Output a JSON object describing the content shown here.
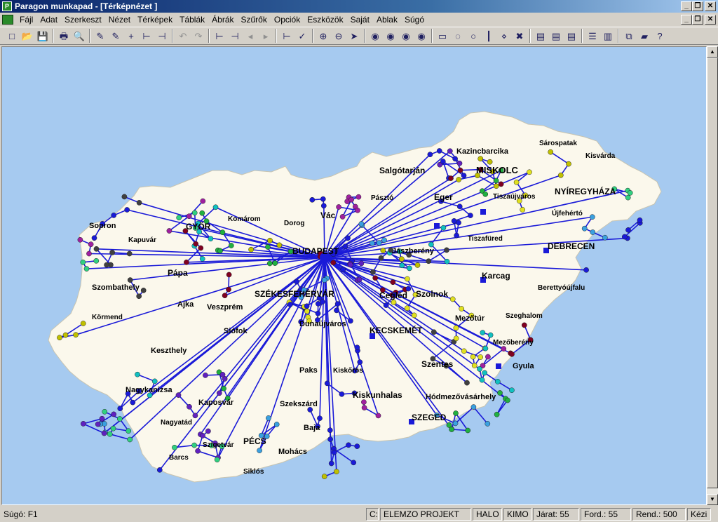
{
  "window": {
    "title": "Paragon munkapad - [Térképnézet ]",
    "controls": [
      "_",
      "❐",
      "✕"
    ]
  },
  "menu": [
    "Fájl",
    "Adat",
    "Szerkeszt",
    "Nézet",
    "Térképek",
    "Táblák",
    "Ábrák",
    "Szűrők",
    "Opciók",
    "Eszközök",
    "Saját",
    "Ablak",
    "Súgó"
  ],
  "toolbar": {
    "icons": [
      "new-icon",
      "open-icon",
      "save-icon",
      "print-icon",
      "print-preview-icon",
      "edit-route-icon",
      "edit-stop-icon",
      "add-stop-icon",
      "split-icon",
      "merge-icon",
      "undo-icon",
      "redo-icon",
      "move-left-icon",
      "move-right-icon",
      "arrow-left-icon",
      "arrow-right-icon",
      "insert-icon",
      "check-icon",
      "zoom-in-icon",
      "zoom-out-icon",
      "pointer-icon",
      "globe-1-icon",
      "globe-2-icon",
      "globe-3-icon",
      "globe-4-icon",
      "select-rect-icon",
      "select-lasso-icon",
      "select-circle-icon",
      "select-line-icon",
      "select-point-icon",
      "select-clear-icon",
      "table-1-icon",
      "table-2-icon",
      "table-3-icon",
      "chart-table-icon",
      "chart-bar-icon",
      "copy-icon",
      "book-icon",
      "help-icon"
    ],
    "glyphs": [
      "□",
      "📂",
      "💾",
      "🖶",
      "🔍",
      "✎",
      "✎",
      "+",
      "⊢",
      "⊣",
      "↶",
      "↷",
      "⊢",
      "⊣",
      "◂",
      "▸",
      "⊢",
      "✓",
      "⊕",
      "⊖",
      "➤",
      "◉",
      "◉",
      "◉",
      "◉",
      "▭",
      "◌",
      "○",
      "┃",
      "⋄",
      "✖",
      "▤",
      "▤",
      "▤",
      "☰",
      "▥",
      "⧉",
      "▰",
      "?"
    ]
  },
  "map": {
    "hub": "BUDAPEST",
    "cities": [
      {
        "name": "Sopron",
        "size": 11
      },
      {
        "name": "GYŐR",
        "size": 12
      },
      {
        "name": "Komárom",
        "size": 10
      },
      {
        "name": "Dorog",
        "size": 10
      },
      {
        "name": "Vác",
        "size": 12
      },
      {
        "name": "Salgótarján",
        "size": 12
      },
      {
        "name": "Pásztó",
        "size": 10
      },
      {
        "name": "Kazincbarcika",
        "size": 11
      },
      {
        "name": "MISKOLC",
        "size": 13
      },
      {
        "name": "Sárospatak",
        "size": 10
      },
      {
        "name": "Kisvárda",
        "size": 10
      },
      {
        "name": "Tiszaújváros",
        "size": 10
      },
      {
        "name": "NYÍREGYHÁZA",
        "size": 12
      },
      {
        "name": "Újfehértó",
        "size": 10
      },
      {
        "name": "Eger",
        "size": 12
      },
      {
        "name": "Tiszafüred",
        "size": 10
      },
      {
        "name": "DEBRECEN",
        "size": 12
      },
      {
        "name": "Jászberény",
        "size": 11
      },
      {
        "name": "Karcag",
        "size": 12
      },
      {
        "name": "Berettyóújfalu",
        "size": 10
      },
      {
        "name": "Szolnok",
        "size": 12
      },
      {
        "name": "Cegléd",
        "size": 12
      },
      {
        "name": "Mezőtúr",
        "size": 11
      },
      {
        "name": "Szeghalom",
        "size": 10
      },
      {
        "name": "Mezőberény",
        "size": 10
      },
      {
        "name": "Gyula",
        "size": 11
      },
      {
        "name": "KECSKEMÉT",
        "size": 12
      },
      {
        "name": "Szentes",
        "size": 12
      },
      {
        "name": "Hódmezővásárhely",
        "size": 11
      },
      {
        "name": "SZEGED",
        "size": 12
      },
      {
        "name": "Kiskunhalas",
        "size": 12
      },
      {
        "name": "Kiskőrös",
        "size": 10
      },
      {
        "name": "Dunaújváros",
        "size": 11
      },
      {
        "name": "SZÉKESFEHÉRVÁR",
        "size": 12
      },
      {
        "name": "Pápa",
        "size": 12
      },
      {
        "name": "Kapuvár",
        "size": 10
      },
      {
        "name": "Szombathely",
        "size": 11
      },
      {
        "name": "Ajka",
        "size": 11
      },
      {
        "name": "Veszprém",
        "size": 11
      },
      {
        "name": "Siófok",
        "size": 11
      },
      {
        "name": "Körmend",
        "size": 10
      },
      {
        "name": "Keszthely",
        "size": 11
      },
      {
        "name": "Paks",
        "size": 11
      },
      {
        "name": "Szekszárd",
        "size": 11
      },
      {
        "name": "Nagykanizsa",
        "size": 11
      },
      {
        "name": "Kaposvár",
        "size": 11
      },
      {
        "name": "Nagyatád",
        "size": 10
      },
      {
        "name": "Szigetvár",
        "size": 10
      },
      {
        "name": "PÉCS",
        "size": 12
      },
      {
        "name": "Barcs",
        "size": 10
      },
      {
        "name": "Siklós",
        "size": 10
      },
      {
        "name": "Mohács",
        "size": 11
      },
      {
        "name": "Baja",
        "size": 11
      }
    ]
  },
  "status": {
    "help": "Súgó: F1",
    "drive": "C:",
    "project": "ELEMZO PROJEKT",
    "halo": "HALO",
    "kimo": "KIMO",
    "jarat": "Járat: 55",
    "ford": "Ford.: 55",
    "rend": "Rend.: 500",
    "kezi": "Kézi"
  },
  "colors": {
    "water": "#a6caf0",
    "land": "#fbf8ec",
    "route": "#1a1ad8",
    "titlebar": "#0a246a"
  }
}
